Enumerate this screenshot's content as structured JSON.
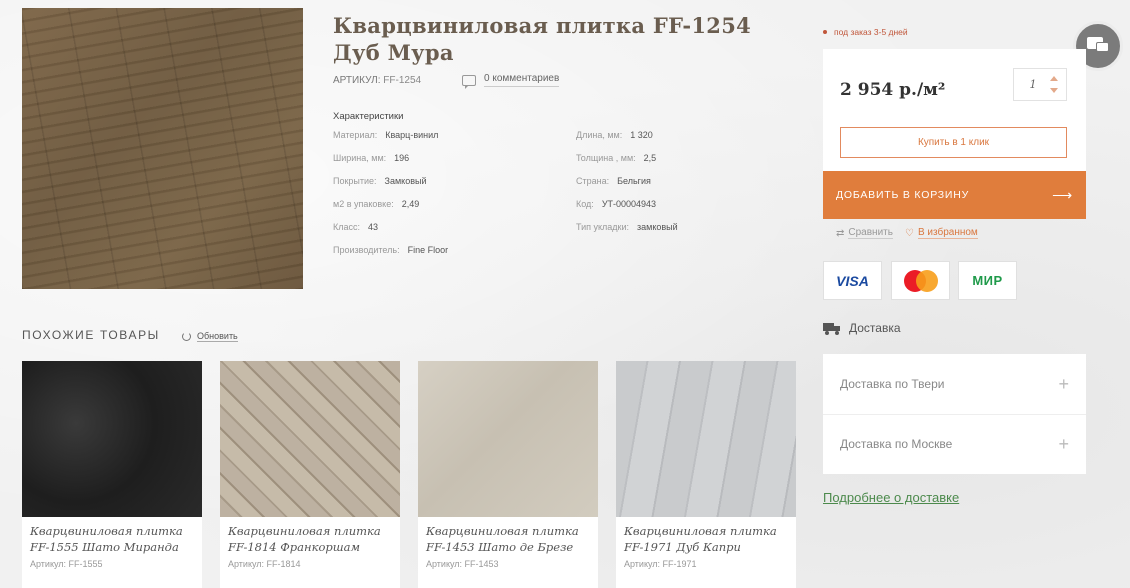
{
  "product": {
    "title": "Кварцвиниловая плитка FF-1254 Дуб Мура",
    "sku_label": "АРТИКУЛ:",
    "sku_value": "FF-1254",
    "comments": "0 комментариев",
    "characteristics_title": "Характеристики",
    "characteristics": [
      {
        "label": "Материал:",
        "value": "Кварц-винил"
      },
      {
        "label": "Ширина, мм:",
        "value": "196"
      },
      {
        "label": "Покрытие:",
        "value": "Замковый"
      },
      {
        "label": "м2 в упаковке:",
        "value": "2,49"
      },
      {
        "label": "Класс:",
        "value": "43"
      },
      {
        "label": "Производитель:",
        "value": "Fine Floor"
      },
      {
        "label": "Длина, мм:",
        "value": "1 320"
      },
      {
        "label": "Толщина , мм:",
        "value": "2,5"
      },
      {
        "label": "Страна:",
        "value": "Бельгия"
      },
      {
        "label": "Код:",
        "value": "УТ-00004943"
      },
      {
        "label": "Тип укладки:",
        "value": "замковый"
      }
    ]
  },
  "similar": {
    "title": "ПОХОЖИЕ ТОВАРЫ",
    "refresh": "Обновить",
    "items": [
      {
        "name": "Кварцвиниловая плитка FF-1555 Шато Миранда",
        "art": "Артикул: FF-1555"
      },
      {
        "name": "Кварцвиниловая плитка FF-1814 Франкоршам",
        "art": "Артикул: FF-1814"
      },
      {
        "name": "Кварцвиниловая плитка FF-1453 Шато де Брезе",
        "art": "Артикул: FF-1453"
      },
      {
        "name": "Кварцвиниловая плитка FF-1971 Дуб Капри",
        "art": "Артикул: FF-1971"
      }
    ]
  },
  "buy": {
    "order_note": "под заказ 3-5 дней",
    "price": "2 954 р./м²",
    "quantity": "1",
    "one_click": "Купить в 1 клик",
    "add_to_cart": "ДОБАВИТЬ В КОРЗИНУ",
    "arrow": "⟶",
    "compare": "Сравнить",
    "favorite": "В избранном",
    "payment": {
      "visa": "VISA",
      "mir": "МИР"
    }
  },
  "delivery": {
    "title": "Доставка",
    "rows": [
      {
        "label": "Доставка по Твери",
        "icon": "+"
      },
      {
        "label": "Доставка по Москве",
        "icon": "+"
      }
    ],
    "more": "Подробнее о доставке"
  },
  "colors": {
    "accent": "#e07d3c",
    "link_green": "#4c8a4c"
  }
}
